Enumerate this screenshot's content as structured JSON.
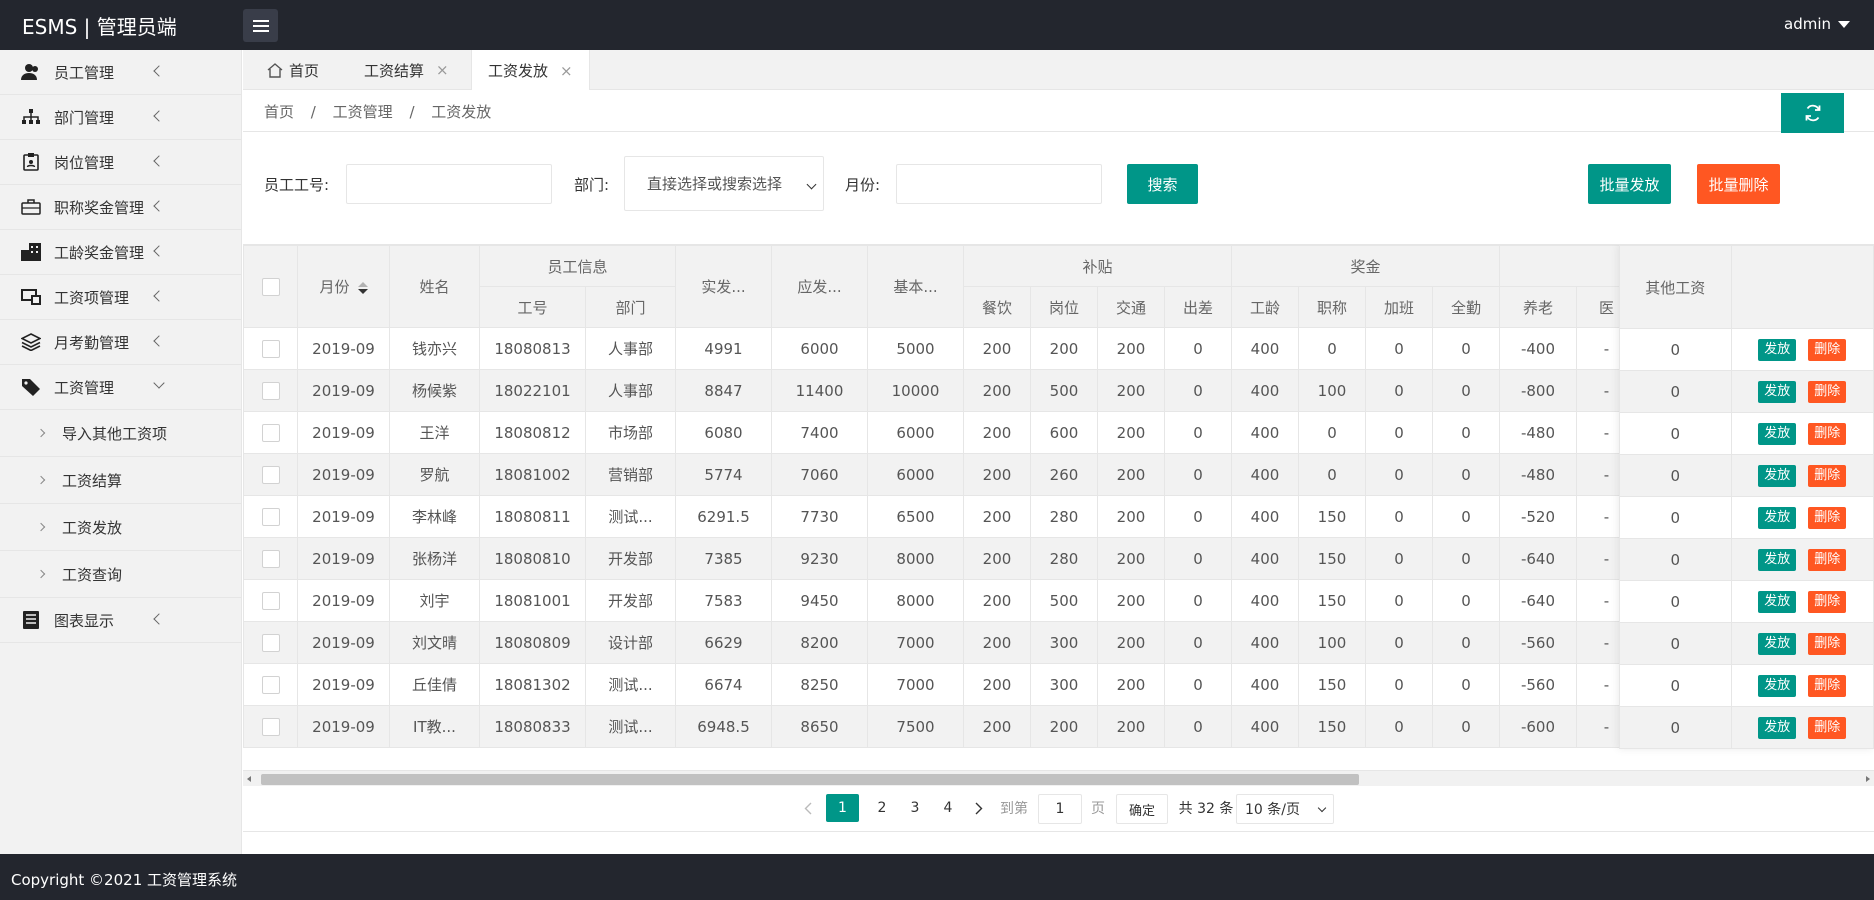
{
  "header": {
    "logo": "ESMS | 管理员端",
    "user": "admin"
  },
  "sidebar": {
    "items": [
      {
        "label": "员工管理",
        "icon": "users-icon"
      },
      {
        "label": "部门管理",
        "icon": "sitemap-icon"
      },
      {
        "label": "岗位管理",
        "icon": "badge-icon"
      },
      {
        "label": "职称奖金管理",
        "icon": "briefcase-icon"
      },
      {
        "label": "工龄奖金管理",
        "icon": "building-icon"
      },
      {
        "label": "工资项管理",
        "icon": "monitor-icon"
      },
      {
        "label": "月考勤管理",
        "icon": "layers-icon"
      },
      {
        "label": "工资管理",
        "icon": "tag-icon"
      },
      {
        "label": "图表显示",
        "icon": "list-icon"
      }
    ],
    "sub_items": [
      "导入其他工资项",
      "工资结算",
      "工资发放",
      "工资查询"
    ]
  },
  "tabs": [
    {
      "label": "首页"
    },
    {
      "label": "工资结算",
      "close": "×"
    },
    {
      "label": "工资发放",
      "close": "×"
    }
  ],
  "breadcrumb": [
    "首页",
    "/",
    "工资管理",
    "/",
    "工资发放"
  ],
  "search": {
    "emp_label": "员工工号:",
    "emp_value": "",
    "dept_label": "部门:",
    "dept_value": "直接选择或搜索选择",
    "month_label": "月份:",
    "month_value": "",
    "search_btn": "搜索",
    "batch_send": "批量发放",
    "batch_delete": "批量删除"
  },
  "table": {
    "headers": {
      "month": "月份",
      "name": "姓名",
      "emp_info": "员工信息",
      "emp_no": "工号",
      "dept": "部门",
      "actual": "实发...",
      "due": "应发...",
      "basic": "基本...",
      "subsidy": "补贴",
      "meal": "餐饮",
      "post": "岗位",
      "traffic": "交通",
      "trip": "出差",
      "bonus": "奖金",
      "seniority": "工龄",
      "title": "职称",
      "overtime": "加班",
      "attendance": "全勤",
      "pension": "养老",
      "other": "其他工资"
    },
    "rows": [
      {
        "month": "2019-09",
        "name": "钱亦兴",
        "emp_no": "18080813",
        "dept": "人事部",
        "actual": "4991",
        "due": "6000",
        "basic": "5000",
        "meal": "200",
        "post": "200",
        "traffic": "200",
        "trip": "0",
        "seniority": "400",
        "title": "0",
        "overtime": "0",
        "attendance": "0",
        "pension": "-400",
        "cut": "-",
        "other": "0"
      },
      {
        "month": "2019-09",
        "name": "杨候紫",
        "emp_no": "18022101",
        "dept": "人事部",
        "actual": "8847",
        "due": "11400",
        "basic": "10000",
        "meal": "200",
        "post": "500",
        "traffic": "200",
        "trip": "0",
        "seniority": "400",
        "title": "100",
        "overtime": "0",
        "attendance": "0",
        "pension": "-800",
        "cut": "-",
        "other": "0"
      },
      {
        "month": "2019-09",
        "name": "王洋",
        "emp_no": "18080812",
        "dept": "市场部",
        "actual": "6080",
        "due": "7400",
        "basic": "6000",
        "meal": "200",
        "post": "600",
        "traffic": "200",
        "trip": "0",
        "seniority": "400",
        "title": "0",
        "overtime": "0",
        "attendance": "0",
        "pension": "-480",
        "cut": "-",
        "other": "0"
      },
      {
        "month": "2019-09",
        "name": "罗航",
        "emp_no": "18081002",
        "dept": "营销部",
        "actual": "5774",
        "due": "7060",
        "basic": "6000",
        "meal": "200",
        "post": "260",
        "traffic": "200",
        "trip": "0",
        "seniority": "400",
        "title": "0",
        "overtime": "0",
        "attendance": "0",
        "pension": "-480",
        "cut": "-",
        "other": "0"
      },
      {
        "month": "2019-09",
        "name": "李林峰",
        "emp_no": "18080811",
        "dept": "测试...",
        "actual": "6291.5",
        "due": "7730",
        "basic": "6500",
        "meal": "200",
        "post": "280",
        "traffic": "200",
        "trip": "0",
        "seniority": "400",
        "title": "150",
        "overtime": "0",
        "attendance": "0",
        "pension": "-520",
        "cut": "-",
        "other": "0"
      },
      {
        "month": "2019-09",
        "name": "张杨洋",
        "emp_no": "18080810",
        "dept": "开发部",
        "actual": "7385",
        "due": "9230",
        "basic": "8000",
        "meal": "200",
        "post": "280",
        "traffic": "200",
        "trip": "0",
        "seniority": "400",
        "title": "150",
        "overtime": "0",
        "attendance": "0",
        "pension": "-640",
        "cut": "-",
        "other": "0"
      },
      {
        "month": "2019-09",
        "name": "刘宇",
        "emp_no": "18081001",
        "dept": "开发部",
        "actual": "7583",
        "due": "9450",
        "basic": "8000",
        "meal": "200",
        "post": "500",
        "traffic": "200",
        "trip": "0",
        "seniority": "400",
        "title": "150",
        "overtime": "0",
        "attendance": "0",
        "pension": "-640",
        "cut": "-",
        "other": "0"
      },
      {
        "month": "2019-09",
        "name": "刘文晴",
        "emp_no": "18080809",
        "dept": "设计部",
        "actual": "6629",
        "due": "8200",
        "basic": "7000",
        "meal": "200",
        "post": "300",
        "traffic": "200",
        "trip": "0",
        "seniority": "400",
        "title": "100",
        "overtime": "0",
        "attendance": "0",
        "pension": "-560",
        "cut": "-",
        "other": "0"
      },
      {
        "month": "2019-09",
        "name": "丘佳倩",
        "emp_no": "18081302",
        "dept": "测试...",
        "actual": "6674",
        "due": "8250",
        "basic": "7000",
        "meal": "200",
        "post": "300",
        "traffic": "200",
        "trip": "0",
        "seniority": "400",
        "title": "150",
        "overtime": "0",
        "attendance": "0",
        "pension": "-560",
        "cut": "-",
        "other": "0"
      },
      {
        "month": "2019-09",
        "name": "IT教...",
        "emp_no": "18080833",
        "dept": "测试...",
        "actual": "6948.5",
        "due": "8650",
        "basic": "7500",
        "meal": "200",
        "post": "200",
        "traffic": "200",
        "trip": "0",
        "seniority": "400",
        "title": "150",
        "overtime": "0",
        "attendance": "0",
        "pension": "-600",
        "cut": "-",
        "other": "0"
      }
    ],
    "actions": {
      "send": "发放",
      "delete": "删除"
    }
  },
  "pager": {
    "pages": [
      "1",
      "2",
      "3",
      "4"
    ],
    "current": "1",
    "goto_label": "到第",
    "goto_value": "1",
    "page_unit": "页",
    "confirm": "确定",
    "total": "共 32 条",
    "per_page": "10 条/页"
  },
  "footer": {
    "text": "Copyright ©2021 工资管理系统"
  },
  "colors": {
    "header": "#23262e",
    "accent": "#009688",
    "danger": "#ff5722"
  }
}
